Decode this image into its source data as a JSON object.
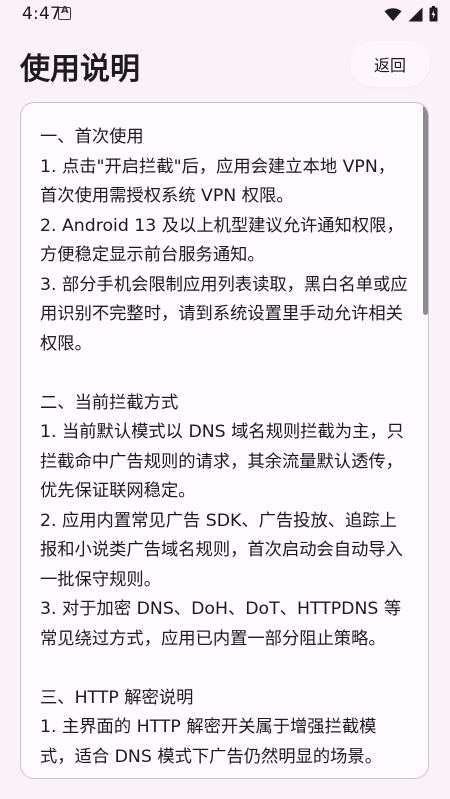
{
  "status_bar": {
    "time": "4:47",
    "icons": [
      "app-notification-icon",
      "wifi-icon",
      "signal-icon",
      "battery-icon"
    ]
  },
  "header": {
    "title": "使用说明",
    "back_label": "返回"
  },
  "content": {
    "sections": [
      {
        "heading": "一、首次使用",
        "items": [
          "1. 点击\"开启拦截\"后，应用会建立本地 VPN，首次使用需授权系统 VPN 权限。",
          "2. Android 13 及以上机型建议允许通知权限，方便稳定显示前台服务通知。",
          "3. 部分手机会限制应用列表读取，黑白名单或应用识别不完整时，请到系统设置里手动允许相关权限。"
        ]
      },
      {
        "heading": "二、当前拦截方式",
        "items": [
          "1. 当前默认模式以 DNS 域名规则拦截为主，只拦截命中广告规则的请求，其余流量默认透传，优先保证联网稳定。",
          "2. 应用内置常见广告 SDK、广告投放、追踪上报和小说类广告域名规则，首次启动会自动导入一批保守规则。",
          "3. 对于加密 DNS、DoH、DoT、HTTPDNS 等常见绕过方式，应用已内置一部分阻止策略。"
        ]
      },
      {
        "heading": "三、HTTP 解密说明",
        "items": [
          "1. 主界面的 HTTP 解密开关属于增强拦截模式，适合 DNS 模式下广告仍然明显的场景。"
        ]
      }
    ]
  },
  "colors": {
    "background": "#fbf2f8",
    "card": "#fffbfe",
    "border": "#c9c4cf",
    "text": "#1d1b20"
  }
}
